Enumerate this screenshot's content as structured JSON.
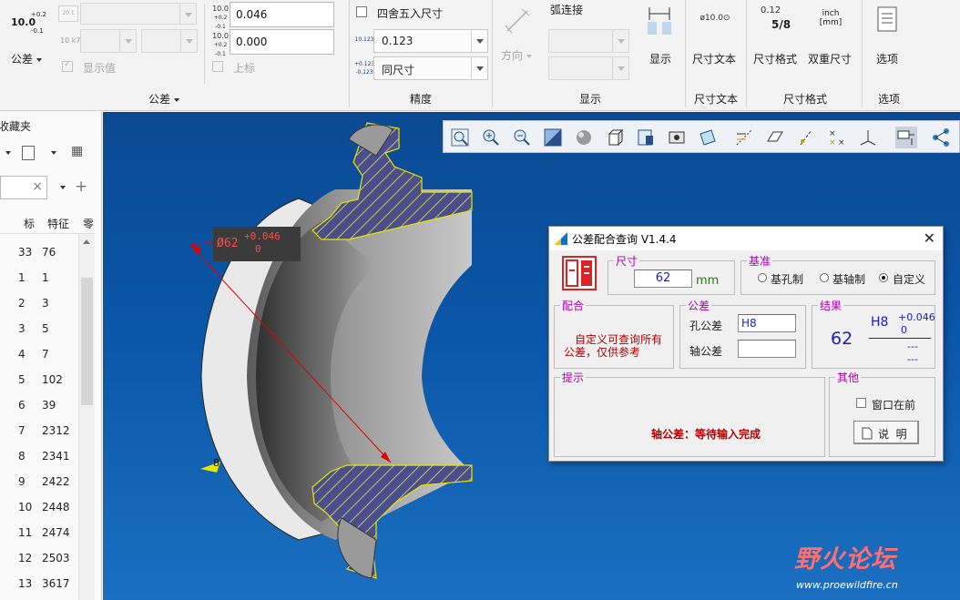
{
  "ribbon": {
    "tolerance": {
      "big_button_label": "公差",
      "big_button_glyph": "10.0",
      "big_button_sup": "+0.2",
      "big_button_sub": "-0.1",
      "show_value_label": "显示值",
      "upper_label": "上标",
      "upper_value": "0.046",
      "lower_value": "0.000",
      "group_label": "公差"
    },
    "precision": {
      "round_label": "四舍五入尺寸",
      "precision_value": "0.123",
      "tol_format_value": "同尺寸",
      "group_label": "精度"
    },
    "display": {
      "arc_label": "弧连接",
      "direction_label": "方向",
      "show_label": "显示",
      "group_label": "显示"
    },
    "dim_text": {
      "button_label": "尺寸文本",
      "group_label": "尺寸文本"
    },
    "dim_format": {
      "format_label": "尺寸格式",
      "dual_label": "双重尺寸",
      "group_label": "尺寸格式",
      "format_glyph_top": "0.12",
      "format_glyph_bot": "5/8",
      "dual_glyph_top": "inch",
      "dual_glyph_bot": "[mm]"
    },
    "options": {
      "button_label": "选项",
      "group_label": "选项"
    }
  },
  "left_panel": {
    "title": "收藏夹",
    "col_headers": [
      "标",
      "特征",
      "零"
    ],
    "rows": [
      [
        "33",
        "76"
      ],
      [
        "1",
        "1"
      ],
      [
        "2",
        "3"
      ],
      [
        "3",
        "5"
      ],
      [
        "4",
        "7"
      ],
      [
        "5",
        "102"
      ],
      [
        "6",
        "39"
      ],
      [
        "7",
        "2312"
      ],
      [
        "8",
        "2341"
      ],
      [
        "9",
        "2422"
      ],
      [
        "10",
        "2448"
      ],
      [
        "11",
        "2474"
      ],
      [
        "12",
        "2503"
      ],
      [
        "13",
        "3617"
      ]
    ]
  },
  "viewport": {
    "dim_label": "Ø62",
    "dim_tol_upper": "+0.046",
    "dim_tol_lower": "0",
    "small_dim": "8"
  },
  "dialog": {
    "title": "公差配合查询  V1.4.4",
    "size_legend": "尺寸",
    "size_value": "62",
    "size_unit": "mm",
    "basis_legend": "基准",
    "basis_options": [
      "基孔制",
      "基轴制",
      "自定义"
    ],
    "basis_selected": "自定义",
    "fit_legend": "配合",
    "fit_text_1": "自定义可查询所有",
    "fit_text_2": "公差，仅供参考",
    "tol_legend": "公差",
    "hole_label": "孔公差",
    "hole_value": "H8",
    "shaft_label": "轴公差",
    "shaft_value": "",
    "result_legend": "结果",
    "result_size": "62",
    "result_grade": "H8",
    "result_upper": "+0.046",
    "result_lower": "0",
    "result_dash1": "---",
    "result_dash2": "---",
    "hint_legend": "提示",
    "hint_text": "轴公差：等待输入完成",
    "other_legend": "其他",
    "topmost_label": "窗口在前",
    "help_label": "说  明"
  },
  "watermark": {
    "brand": "野火论坛",
    "url": "www.proewildfire.cn"
  },
  "colors": {
    "viewport_top": "#0b4a92",
    "viewport_bottom": "#1b6fc0",
    "dim_red": "#e00000",
    "section_yellow": "#e6e600",
    "dialog_legend": "#b000b0",
    "result_blue": "#1a1acc",
    "hint_red": "#b00000"
  }
}
